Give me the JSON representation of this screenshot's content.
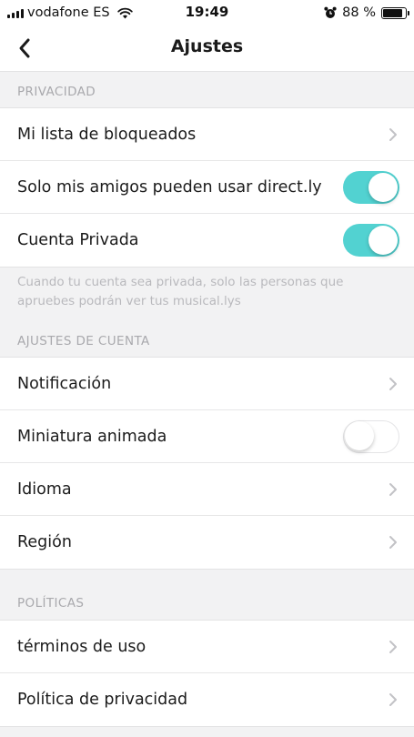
{
  "status_bar": {
    "carrier": "vodafone ES",
    "time": "19:49",
    "battery_percent": "88 %",
    "battery_level": 0.88,
    "icons": [
      "signal-icon",
      "wifi-icon",
      "alarm-icon",
      "battery-icon"
    ]
  },
  "nav": {
    "title": "Ajustes",
    "back_icon": "chevron-left-icon"
  },
  "sections": {
    "privacy": {
      "header": "PRIVACIDAD",
      "items": [
        {
          "label": "Mi lista de bloqueados",
          "control": "chevron"
        },
        {
          "label": "Solo mis amigos pueden usar direct.ly",
          "control": "toggle",
          "value": true
        },
        {
          "label": "Cuenta Privada",
          "control": "toggle",
          "value": true
        }
      ],
      "footnote": "Cuando tu cuenta sea privada, solo las personas que apruebes podrán ver tus musical.lys"
    },
    "account": {
      "header": "AJUSTES DE CUENTA",
      "items": [
        {
          "label": "Notificación",
          "control": "chevron"
        },
        {
          "label": "Miniatura animada",
          "control": "toggle",
          "value": false
        },
        {
          "label": "Idioma",
          "control": "chevron"
        },
        {
          "label": "Región",
          "control": "chevron"
        }
      ]
    },
    "policies": {
      "header": "POLÍTICAS",
      "items": [
        {
          "label": "términos de uso",
          "control": "chevron"
        },
        {
          "label": "Política de privacidad",
          "control": "chevron"
        }
      ]
    }
  },
  "colors": {
    "toggle_on": "#52d2d1",
    "background": "#f2f2f3",
    "section_header": "#a9a9ad"
  }
}
